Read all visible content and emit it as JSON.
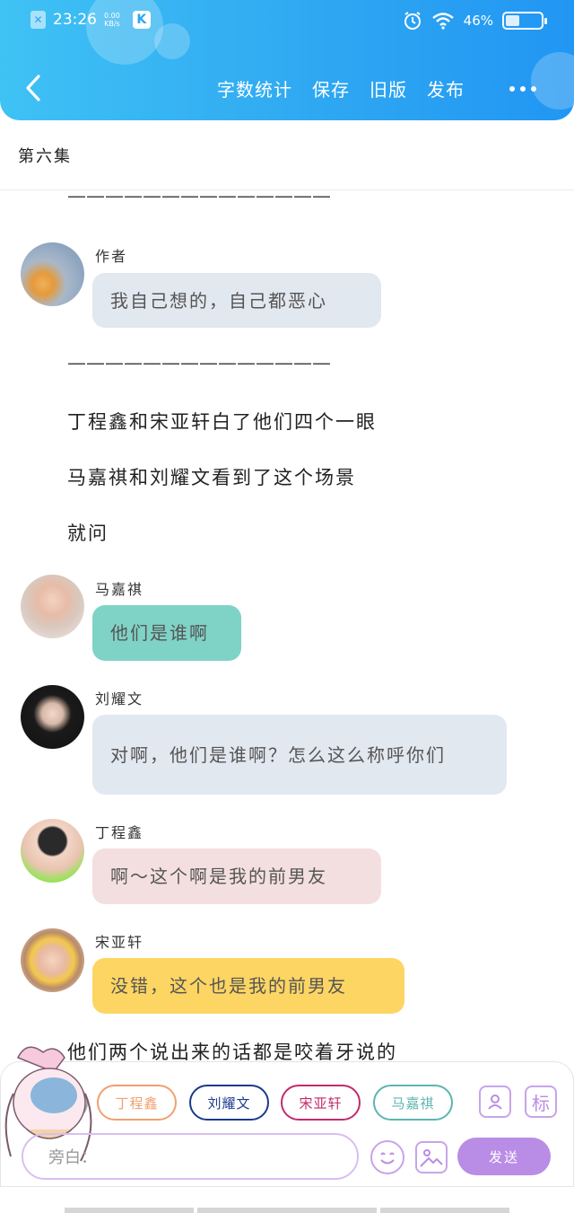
{
  "status_bar": {
    "time": "23:26",
    "net_speed_top": "0.00",
    "net_speed_bottom": "KB/s",
    "battery": "46%",
    "battery_level": 0.46
  },
  "toolbar": {
    "word_count": "字数统计",
    "save": "保存",
    "old_version": "旧版",
    "publish": "发布"
  },
  "chapter_title": "第六集",
  "content": {
    "divider_top": "——————————————",
    "divider_mid": "——————————————",
    "author_name": "作者",
    "author_msg": "我自己想的，自己都恶心",
    "narration_1": "丁程鑫和宋亚轩白了他们四个一眼",
    "narration_2": "马嘉祺和刘耀文看到了这个场景",
    "narration_3": "就问",
    "messages": [
      {
        "speaker": "马嘉祺",
        "text": "他们是谁啊",
        "color": "#7fd3c6"
      },
      {
        "speaker": "刘耀文",
        "text": "对啊，他们是谁啊？怎么这么称呼你们",
        "color": "#e2e8f0"
      },
      {
        "speaker": "丁程鑫",
        "text": "啊～这个啊是我的前男友",
        "color": "#f4dfe0"
      },
      {
        "speaker": "宋亚轩",
        "text": "没错，这个也是我的前男友",
        "color": "#fdd563"
      }
    ],
    "narration_4": "他们两个说出来的话都是咬着牙说的"
  },
  "composer": {
    "characters": [
      {
        "name": "旁白",
        "color": "#9aa5b1"
      },
      {
        "name": "丁程鑫",
        "color": "#f0a070"
      },
      {
        "name": "刘耀文",
        "color": "#1a3a8c"
      },
      {
        "name": "宋亚轩",
        "color": "#c22b6a"
      },
      {
        "name": "马嘉祺",
        "color": "#5db5b1"
      }
    ],
    "role_icon": "role-icon",
    "tag_label": "标",
    "input_placeholder": "旁白：",
    "send_label": "发送"
  },
  "colors": {
    "header_start": "#3fc2f4",
    "header_end": "#2196f3",
    "accent_purple": "#b98de6"
  }
}
